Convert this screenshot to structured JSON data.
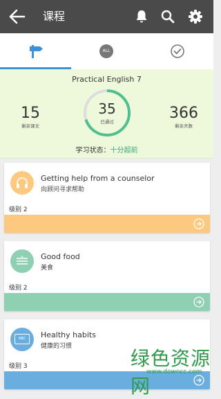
{
  "header": {
    "title": "课程",
    "back_icon": "arrow-left-icon",
    "icons": [
      "bell-icon",
      "search-icon",
      "gear-icon"
    ]
  },
  "tabs": [
    {
      "icon": "signpost-icon",
      "active": true
    },
    {
      "icon": "all-badge-icon",
      "label": "ALL",
      "active": false
    },
    {
      "icon": "check-circle-icon",
      "active": false
    }
  ],
  "summary": {
    "course_name": "Practical English 7",
    "remaining_lessons": {
      "value": "15",
      "label": "剩余课文"
    },
    "passed": {
      "value": "35",
      "label": "已通过",
      "progress": 0.7
    },
    "remaining_days": {
      "value": "366",
      "label": "剩余天数"
    },
    "status_label": "学习状态：",
    "status_value": "十分超前"
  },
  "lessons": [
    {
      "title_en": "Getting help from a counselor",
      "title_cn": "向顾问寻求帮助",
      "level": "级别 2",
      "color": "#fdc980",
      "icon": "headphones-icon"
    },
    {
      "title_en": "Good food",
      "title_cn": "美食",
      "level": "级别 2",
      "color": "#8fcfb2",
      "icon": "menu-lines-icon"
    },
    {
      "title_en": "Healthy habits",
      "title_cn": "健康的习惯",
      "level": "级别 3",
      "color": "#6aaee0",
      "icon": "abc-card-icon",
      "icon_text": "ABC"
    }
  ],
  "watermark": {
    "text": "绿色资源网",
    "url": "www.downcc.com"
  },
  "colors": {
    "appbar": "#4a4a4a",
    "accent_blue": "#3d8fd8",
    "ring_green": "#4fc08d",
    "summary_bg": "#eef9dc"
  }
}
